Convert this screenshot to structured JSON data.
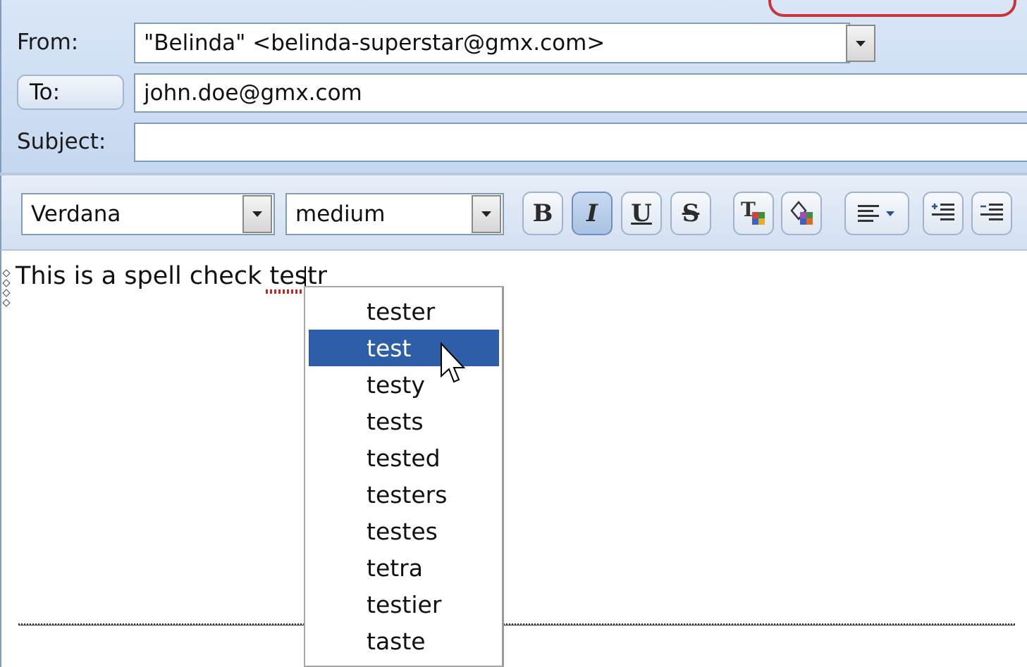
{
  "compose": {
    "from_label": "From:",
    "from_value": "\"Belinda\" <belinda-superstar@gmx.com>",
    "to_button": "To:",
    "to_value": "john.doe@gmx.com",
    "subject_label": "Subject:",
    "subject_value": ""
  },
  "toolbar": {
    "font": "Verdana",
    "size": "medium",
    "bold": "B",
    "italic": "I",
    "underline": "U",
    "strike": "S"
  },
  "editor": {
    "text_before": "This is a spell check ",
    "misspelled_word": "testr"
  },
  "suggestions": [
    "tester",
    "test",
    "testy",
    "tests",
    "tested",
    "testers",
    "testes",
    "tetra",
    "testier",
    "taste"
  ],
  "selected_suggestion_index": 1,
  "colors": {
    "selection": "#2f5ea8",
    "header_bg": "#c5d7ef",
    "border": "#7f9db9",
    "spell_error": "#d02020"
  }
}
